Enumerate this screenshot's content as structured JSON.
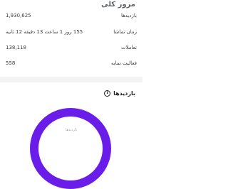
{
  "overview": {
    "title": "مرور کلی"
  },
  "stats": [
    {
      "label": "بازدیدها",
      "value": "1,930,625"
    },
    {
      "label": "زمان تماشا",
      "value": "155 روز 1 ساعت 13 دقیقه 12 ثانیه"
    },
    {
      "label": "تعاملات",
      "value": "138,118"
    },
    {
      "label": "فعالیت نمایه",
      "value": "558"
    }
  ],
  "views_section": {
    "title": "بازدیدها",
    "info_icon": "info-icon",
    "chart_center_label": "بازدیدها"
  },
  "colors": {
    "accent": "#6a1de8"
  }
}
